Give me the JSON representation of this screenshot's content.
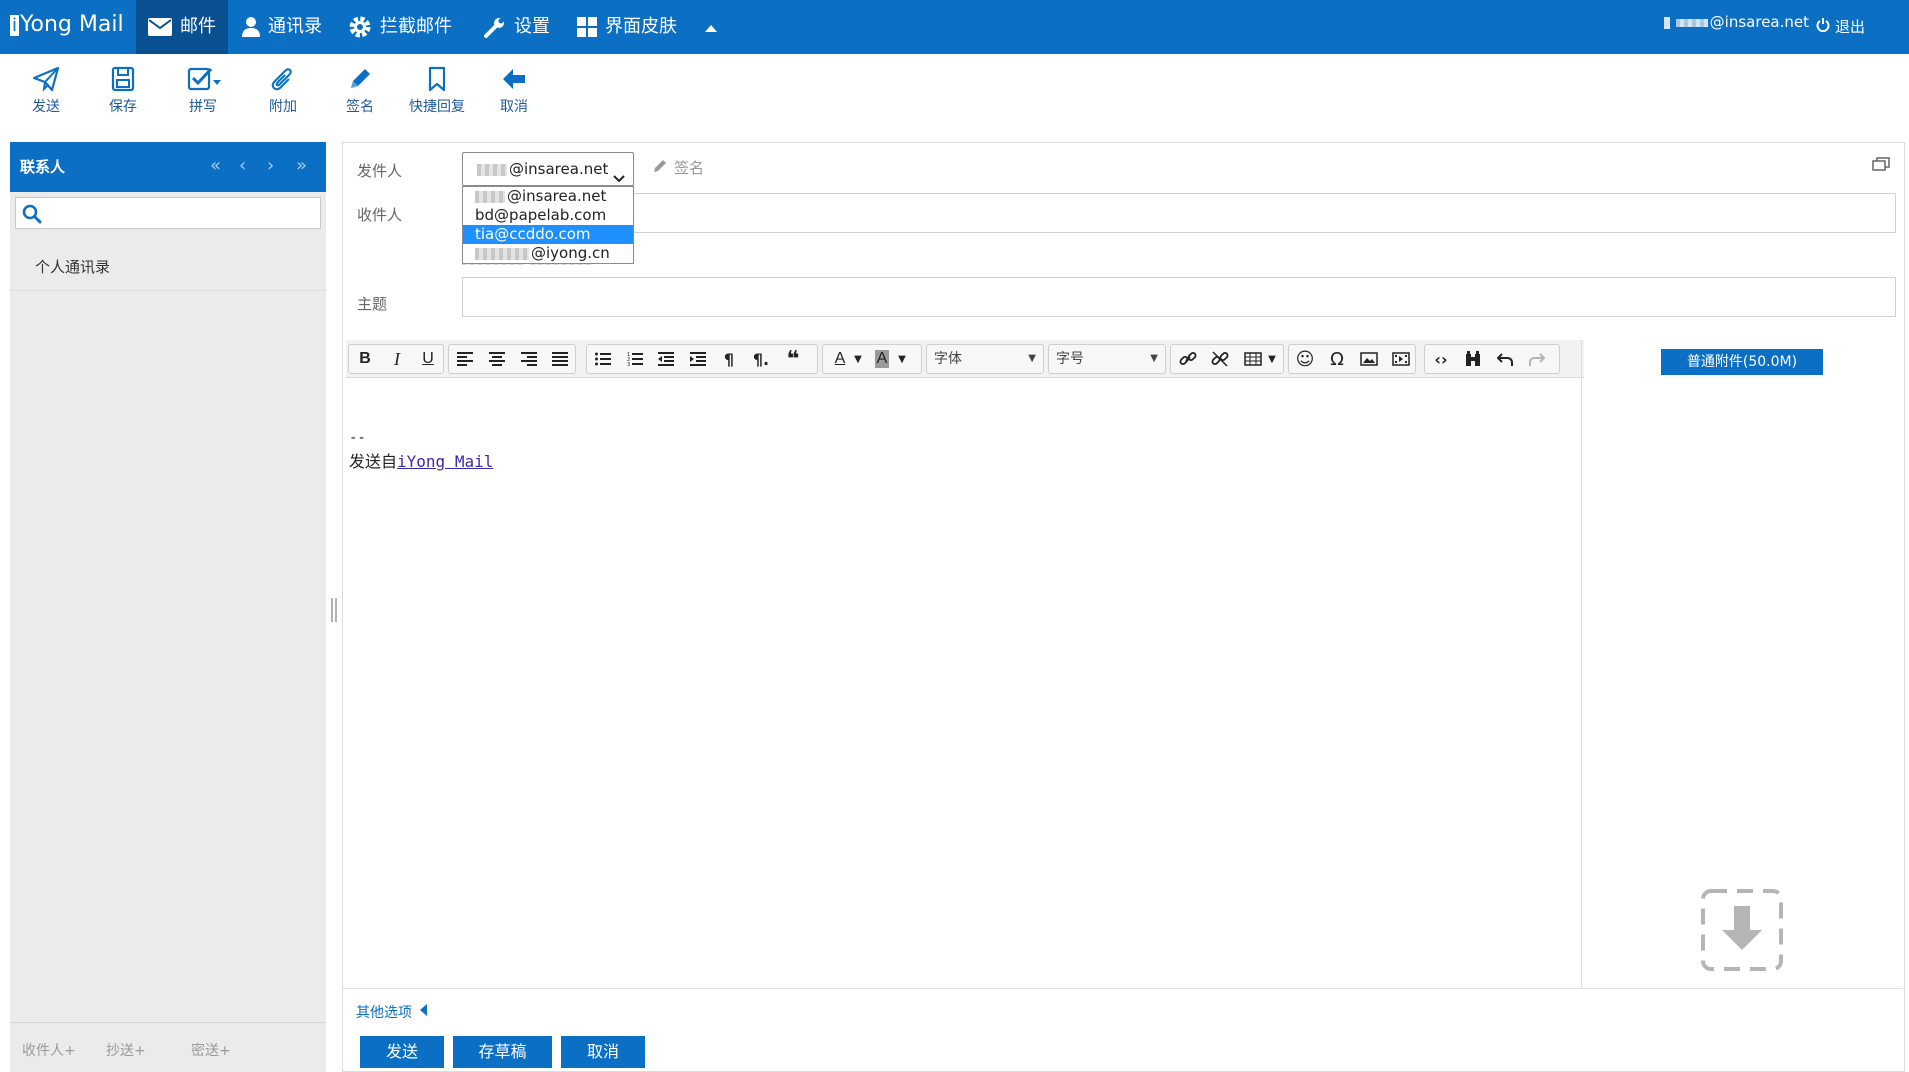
{
  "app": {
    "logo_i": "i",
    "logo_text": "Yong Mail"
  },
  "nav": {
    "items": [
      {
        "label": "邮件",
        "icon": "envelope-icon",
        "active": true
      },
      {
        "label": "通讯录",
        "icon": "person-icon"
      },
      {
        "label": "拦截邮件",
        "icon": "gear-icon"
      },
      {
        "label": "设置",
        "icon": "wrench-icon"
      },
      {
        "label": "界面皮肤",
        "icon": "grid-icon"
      }
    ],
    "user_email": "@insarea.net",
    "logout": "退出"
  },
  "toolbar": {
    "send": "发送",
    "save": "保存",
    "spell": "拼写",
    "attach": "附加",
    "signature": "签名",
    "quick_reply": "快捷回复",
    "cancel": "取消"
  },
  "sidebar": {
    "title": "联系人",
    "address_book": "个人通讯录",
    "bottom": {
      "to": "收件人+",
      "cc": "抄送+",
      "bcc": "密送+"
    }
  },
  "compose": {
    "from_label": "发件人",
    "from_value": "@insarea.net",
    "signature_link": "签名",
    "to_label": "收件人",
    "subject_label": "主题",
    "from_options": [
      {
        "text": "@insarea.net",
        "blurred": true
      },
      {
        "text": "bd@papelab.com",
        "blurred": false
      },
      {
        "text": "tia@ccddo.com",
        "blurred": false,
        "selected": true
      },
      {
        "text": "@iyong.cn",
        "blurred": true
      }
    ]
  },
  "editor": {
    "font_select": "字体",
    "size_select": "字号",
    "signature_dashes": "--",
    "signature_prefix": "发送自",
    "signature_link": "iYong Mail"
  },
  "attachment": {
    "button": "普通附件(50.0M)"
  },
  "footer": {
    "other_options": "其他选项",
    "send": "发送",
    "save_draft": "存草稿",
    "cancel": "取消"
  },
  "colors": {
    "brand": "#0b6fc4",
    "brand_dark": "#08508f",
    "highlight": "#1e90ff"
  }
}
